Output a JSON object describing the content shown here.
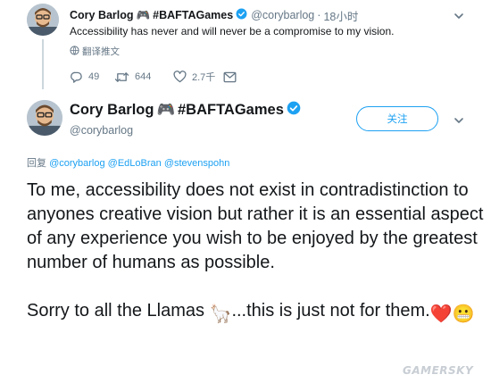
{
  "parent_tweet": {
    "author_name": "Cory Barlog",
    "author_emoji": "🎮",
    "hashtag": "#BAFTAGames",
    "handle": "@corybarlog",
    "separator": "·",
    "time": "18小时",
    "text": "Accessibility has never and will never be a compromise to my vision.",
    "translate_label": "翻译推文",
    "reply_count": "49",
    "retweet_count": "644",
    "like_count": "2.7千"
  },
  "main_tweet": {
    "author_name": "Cory Barlog",
    "author_emoji": "🎮",
    "hashtag": "#BAFTAGames",
    "handle": "@corybarlog",
    "follow_label": "关注",
    "reply_prefix": "回复",
    "reply_mentions": [
      "@corybarlog",
      "@EdLoBran",
      "@stevenspohn"
    ],
    "paragraph1": "To me, accessibility does not exist in contradistinction to anyones creative vision but rather it is an essential aspect of any experience you wish to be enjoyed by the greatest number of humans as possible.",
    "paragraph2_a": "Sorry to all the Llamas ",
    "paragraph2_emoji1": "🦙",
    "paragraph2_b": "...this is just not for them.",
    "paragraph2_emoji2": "❤️",
    "paragraph2_emoji3": "😬"
  },
  "watermark": "GAMERSKY",
  "colors": {
    "accent": "#1da1f2",
    "secondary_text": "#657786",
    "primary_text": "#14171a",
    "heart": "#e0245e"
  },
  "icons": [
    "avatar",
    "gamepad-emoji",
    "verified-badge-icon",
    "chevron-down-icon",
    "globe-icon",
    "reply-icon",
    "retweet-icon",
    "like-icon",
    "message-icon",
    "llama-emoji",
    "heart-emoji",
    "grimacing-emoji"
  ]
}
